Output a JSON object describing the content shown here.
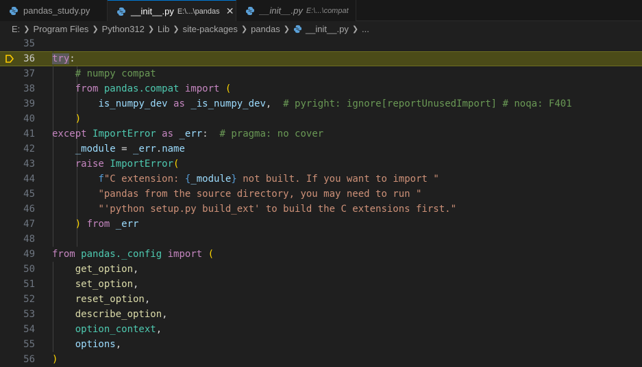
{
  "tabs": [
    {
      "name": "pandas_study.py",
      "path": "",
      "active": false,
      "italic": false
    },
    {
      "name": "__init__.py",
      "path": "E:\\...\\pandas",
      "active": true,
      "italic": false
    },
    {
      "name": "__init__.py",
      "path": "E:\\...\\compat",
      "active": false,
      "italic": true
    }
  ],
  "breadcrumb": {
    "items": [
      "E:",
      "Program Files",
      "Python312",
      "Lib",
      "site-packages",
      "pandas",
      "__init__.py",
      "..."
    ]
  },
  "icons": {
    "python": "python-file-icon",
    "close": "close-icon",
    "chevron": "chevron-right-icon",
    "breakpoint": "debug-stackframe-icon"
  },
  "colors": {
    "accent": "#0078d4",
    "current_line": "#4b4b18",
    "breakpoint": "#ffcc00"
  },
  "editor": {
    "current_line": "36",
    "lines": [
      {
        "num": "35",
        "tokens": []
      },
      {
        "num": "36",
        "tokens": [
          {
            "t": "try",
            "c": "kw"
          },
          {
            "t": ":",
            "c": "plain"
          }
        ]
      },
      {
        "num": "37",
        "tokens": [
          {
            "t": "    "
          },
          {
            "t": "# numpy compat",
            "c": "cm"
          }
        ]
      },
      {
        "num": "38",
        "tokens": [
          {
            "t": "    "
          },
          {
            "t": "from",
            "c": "kw"
          },
          {
            "t": " "
          },
          {
            "t": "pandas.compat",
            "c": "cls"
          },
          {
            "t": " "
          },
          {
            "t": "import",
            "c": "kw"
          },
          {
            "t": " "
          },
          {
            "t": "(",
            "c": "br1"
          }
        ]
      },
      {
        "num": "39",
        "tokens": [
          {
            "t": "        "
          },
          {
            "t": "is_numpy_dev",
            "c": "var"
          },
          {
            "t": " "
          },
          {
            "t": "as",
            "c": "kw"
          },
          {
            "t": " "
          },
          {
            "t": "_is_numpy_dev",
            "c": "var"
          },
          {
            "t": ",  ",
            "c": "plain"
          },
          {
            "t": "# pyright: ignore[reportUnusedImport] # noqa: F401",
            "c": "cm"
          }
        ]
      },
      {
        "num": "40",
        "tokens": [
          {
            "t": "    "
          },
          {
            "t": ")",
            "c": "br1"
          }
        ]
      },
      {
        "num": "41",
        "tokens": [
          {
            "t": "except",
            "c": "kw"
          },
          {
            "t": " "
          },
          {
            "t": "ImportError",
            "c": "cls"
          },
          {
            "t": " "
          },
          {
            "t": "as",
            "c": "kw"
          },
          {
            "t": " "
          },
          {
            "t": "_err",
            "c": "var"
          },
          {
            "t": ":  ",
            "c": "plain"
          },
          {
            "t": "# pragma: no cover",
            "c": "cm"
          }
        ]
      },
      {
        "num": "42",
        "tokens": [
          {
            "t": "    "
          },
          {
            "t": "_module",
            "c": "var"
          },
          {
            "t": " = ",
            "c": "plain"
          },
          {
            "t": "_err",
            "c": "var"
          },
          {
            "t": ".",
            "c": "plain"
          },
          {
            "t": "name",
            "c": "var"
          }
        ]
      },
      {
        "num": "43",
        "tokens": [
          {
            "t": "    "
          },
          {
            "t": "raise",
            "c": "kw"
          },
          {
            "t": " "
          },
          {
            "t": "ImportError",
            "c": "cls"
          },
          {
            "t": "(",
            "c": "br1"
          }
        ]
      },
      {
        "num": "44",
        "tokens": [
          {
            "t": "        "
          },
          {
            "t": "f",
            "c": "kw2"
          },
          {
            "t": "\"C extension: ",
            "c": "str"
          },
          {
            "t": "{",
            "c": "kw2"
          },
          {
            "t": "_module",
            "c": "var"
          },
          {
            "t": "}",
            "c": "kw2"
          },
          {
            "t": " not built. If you want to import \"",
            "c": "str"
          }
        ]
      },
      {
        "num": "45",
        "tokens": [
          {
            "t": "        "
          },
          {
            "t": "\"pandas from the source directory, you may need to run \"",
            "c": "str"
          }
        ]
      },
      {
        "num": "46",
        "tokens": [
          {
            "t": "        "
          },
          {
            "t": "\"'python setup.py build_ext' to build the C extensions first.\"",
            "c": "str"
          }
        ]
      },
      {
        "num": "47",
        "tokens": [
          {
            "t": "    "
          },
          {
            "t": ")",
            "c": "br1"
          },
          {
            "t": " "
          },
          {
            "t": "from",
            "c": "kw"
          },
          {
            "t": " "
          },
          {
            "t": "_err",
            "c": "var"
          }
        ]
      },
      {
        "num": "48",
        "tokens": []
      },
      {
        "num": "49",
        "tokens": [
          {
            "t": "from",
            "c": "kw"
          },
          {
            "t": " "
          },
          {
            "t": "pandas._config",
            "c": "cls"
          },
          {
            "t": " "
          },
          {
            "t": "import",
            "c": "kw"
          },
          {
            "t": " "
          },
          {
            "t": "(",
            "c": "br1"
          }
        ]
      },
      {
        "num": "50",
        "tokens": [
          {
            "t": "    "
          },
          {
            "t": "get_option",
            "c": "fn"
          },
          {
            "t": ",",
            "c": "plain"
          }
        ]
      },
      {
        "num": "51",
        "tokens": [
          {
            "t": "    "
          },
          {
            "t": "set_option",
            "c": "fn"
          },
          {
            "t": ",",
            "c": "plain"
          }
        ]
      },
      {
        "num": "52",
        "tokens": [
          {
            "t": "    "
          },
          {
            "t": "reset_option",
            "c": "fn"
          },
          {
            "t": ",",
            "c": "plain"
          }
        ]
      },
      {
        "num": "53",
        "tokens": [
          {
            "t": "    "
          },
          {
            "t": "describe_option",
            "c": "fn"
          },
          {
            "t": ",",
            "c": "plain"
          }
        ]
      },
      {
        "num": "54",
        "tokens": [
          {
            "t": "    "
          },
          {
            "t": "option_context",
            "c": "cls"
          },
          {
            "t": ",",
            "c": "plain"
          }
        ]
      },
      {
        "num": "55",
        "tokens": [
          {
            "t": "    "
          },
          {
            "t": "options",
            "c": "var"
          },
          {
            "t": ",",
            "c": "plain"
          }
        ]
      },
      {
        "num": "56",
        "tokens": [
          {
            "t": ")",
            "c": "br1"
          }
        ]
      }
    ]
  }
}
